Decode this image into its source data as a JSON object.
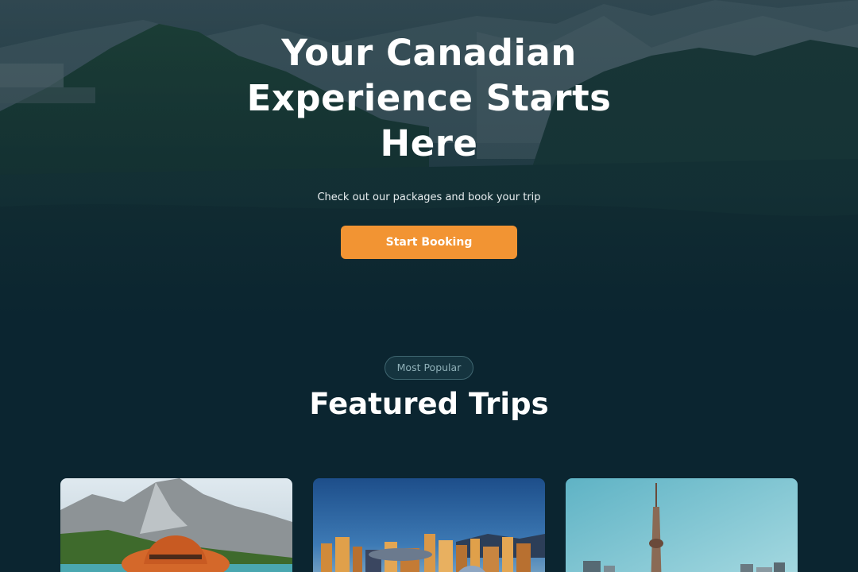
{
  "hero": {
    "title_line1": "Your Canadian",
    "title_line2": "Experience Starts",
    "title_line3": "Here",
    "subtitle": "Check out our packages and book your trip",
    "cta_label": "Start Booking"
  },
  "featured": {
    "badge": "Most Popular",
    "title": "Featured Trips",
    "cards": [
      {
        "image": "mountain-lake-hat-photo"
      },
      {
        "image": "city-skyline-sunset-photo"
      },
      {
        "image": "cn-tower-skyline-photo"
      }
    ]
  },
  "colors": {
    "background": "#0b2530",
    "accent": "#f29433",
    "text": "#ffffff"
  }
}
